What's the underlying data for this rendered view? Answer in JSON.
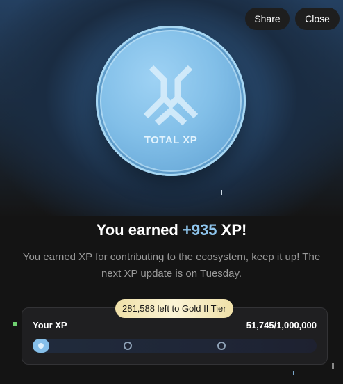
{
  "header": {
    "share_label": "Share",
    "close_label": "Close"
  },
  "coin": {
    "label": "TOTAL XP",
    "icon": "total-xp-logo"
  },
  "headline": {
    "prefix": "You earned ",
    "amount": "+935",
    "suffix": " XP!"
  },
  "description": "You earned XP for contributing to the ecosystem, keep it up! The next XP update is on Tuesday.",
  "progress": {
    "tier_badge": "281,588 left to Gold II Tier",
    "label": "Your XP",
    "count": "51,745/1,000,000",
    "fraction": 0.051745
  },
  "colors": {
    "accent": "#8fc6ee",
    "background": "#141414",
    "badge_gold": "#f6ebc2"
  }
}
